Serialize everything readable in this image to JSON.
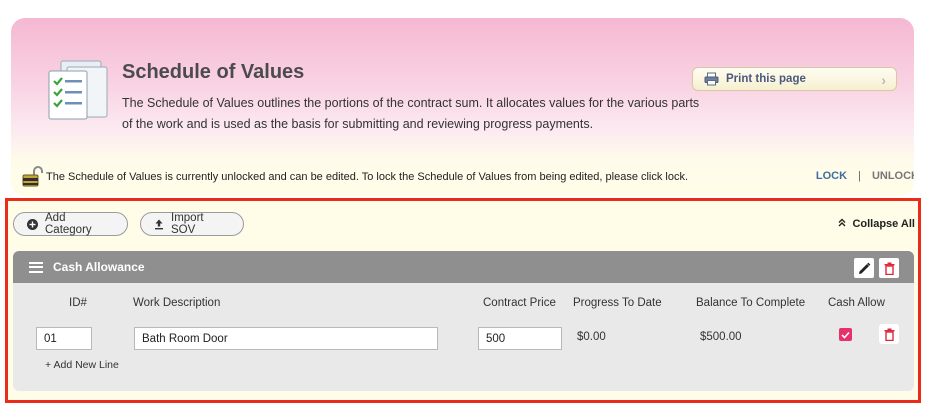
{
  "header": {
    "title": "Schedule of Values",
    "description": "The Schedule of Values outlines the portions of the contract sum. It allocates values for the various parts of the work and is used as the basis for submitting and reviewing progress payments.",
    "print_label": "Print this page",
    "icons": [
      "document-checklist-icon",
      "printer-icon",
      "chevron-right-icon"
    ]
  },
  "lock_bar": {
    "message": "The Schedule of Values is currently unlocked and can be edited. To lock the Schedule of Values from being edited, please click lock.",
    "lock_label": "LOCK",
    "separator": "|",
    "unlock_label": "UNLOCK",
    "icon": "padlock-open-icon"
  },
  "toolbar": {
    "add_category_label": "Add Category",
    "import_sov_label": "Import SOV",
    "collapse_all_label": "Collapse All",
    "collapse_icon": "«"
  },
  "category": {
    "title": "Cash Allowance",
    "columns": {
      "id": "ID#",
      "description": "Work Description",
      "contract_price": "Contract Price",
      "progress": "Progress To Date",
      "balance": "Balance To Complete",
      "cash_allow": "Cash Allow"
    },
    "rows": [
      {
        "id": "01",
        "description": "Bath Room Door",
        "contract_price": "500",
        "progress": "$0.00",
        "balance": "$500.00",
        "cash_allow": true
      }
    ],
    "add_line_label": "+ Add New Line"
  },
  "colors": {
    "accent_red": "#ea2b1a",
    "link_blue": "#3f6e9f",
    "category_header": "#8f8f8f",
    "checkbox_pink": "#e8316b",
    "delete_red": "#e0263a"
  }
}
